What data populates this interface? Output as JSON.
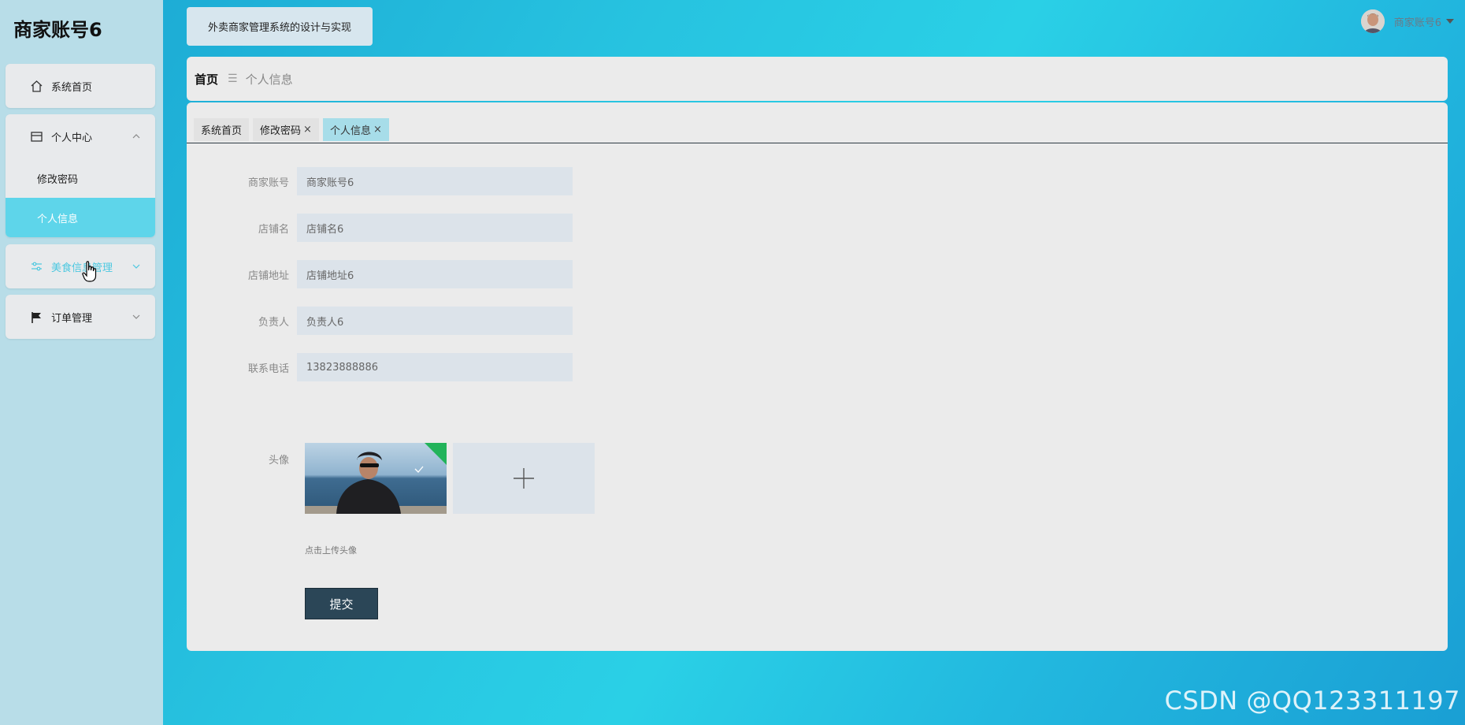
{
  "sidebar": {
    "brand": "商家账号6",
    "menu": {
      "home": "系统首页",
      "personal_center": "个人中心",
      "change_password": "修改密码",
      "personal_info": "个人信息",
      "food_management": "美食信息管理",
      "order_management": "订单管理"
    }
  },
  "header": {
    "system_title": "外卖商家管理系统的设计与实现",
    "user_name": "商家账号6"
  },
  "breadcrumb": {
    "home": "首页",
    "current": "个人信息"
  },
  "tabs": [
    {
      "label": "系统首页",
      "closable": false,
      "active": false
    },
    {
      "label": "修改密码",
      "closable": true,
      "active": false
    },
    {
      "label": "个人信息",
      "closable": true,
      "active": true
    }
  ],
  "form": {
    "account_label": "商家账号",
    "account_value": "商家账号6",
    "shop_name_label": "店铺名",
    "shop_name_value": "店铺名6",
    "shop_address_label": "店铺地址",
    "shop_address_value": "店铺地址6",
    "manager_label": "负责人",
    "manager_value": "负责人6",
    "phone_label": "联系电话",
    "phone_value": "13823888886",
    "avatar_label": "头像",
    "upload_tip": "点击上传头像",
    "submit_label": "提交"
  },
  "watermark": "CSDN @QQ123311197",
  "colors": {
    "accent": "#5ed5ea",
    "submit": "#2b4657",
    "sidebar_bg": "#b8dde8"
  }
}
